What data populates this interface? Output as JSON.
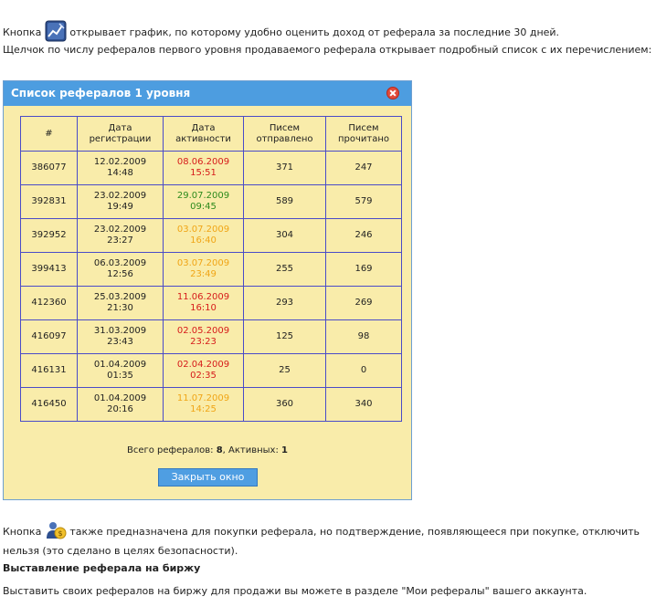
{
  "intro": {
    "line1_prefix": "Кнопка",
    "line1_suffix": "открывает график, по которому удобно оценить доход от реферала за последние 30 дней.",
    "paragraph2": "Щелчок по числу рефералов первого уровня продаваемого реферала открывает подробный список с их перечислением:"
  },
  "dialog": {
    "title": "Список рефералов 1 уровня",
    "headers": [
      "#",
      "Дата регистрации",
      "Дата активности",
      "Писем отправлено",
      "Писем прочитано"
    ],
    "rows": [
      {
        "id": "386077",
        "reg_date": "12.02.2009",
        "reg_time": "14:48",
        "act_date": "08.06.2009",
        "act_time": "15:51",
        "act_color": "red",
        "sent": "371",
        "read": "247"
      },
      {
        "id": "392831",
        "reg_date": "23.02.2009",
        "reg_time": "19:49",
        "act_date": "29.07.2009",
        "act_time": "09:45",
        "act_color": "green",
        "sent": "589",
        "read": "579"
      },
      {
        "id": "392952",
        "reg_date": "23.02.2009",
        "reg_time": "23:27",
        "act_date": "03.07.2009",
        "act_time": "16:40",
        "act_color": "orange",
        "sent": "304",
        "read": "246"
      },
      {
        "id": "399413",
        "reg_date": "06.03.2009",
        "reg_time": "12:56",
        "act_date": "03.07.2009",
        "act_time": "23:49",
        "act_color": "orange",
        "sent": "255",
        "read": "169"
      },
      {
        "id": "412360",
        "reg_date": "25.03.2009",
        "reg_time": "21:30",
        "act_date": "11.06.2009",
        "act_time": "16:10",
        "act_color": "red",
        "sent": "293",
        "read": "269"
      },
      {
        "id": "416097",
        "reg_date": "31.03.2009",
        "reg_time": "23:43",
        "act_date": "02.05.2009",
        "act_time": "23:23",
        "act_color": "red",
        "sent": "125",
        "read": "98"
      },
      {
        "id": "416131",
        "reg_date": "01.04.2009",
        "reg_time": "01:35",
        "act_date": "02.04.2009",
        "act_time": "02:35",
        "act_color": "red",
        "sent": "25",
        "read": "0"
      },
      {
        "id": "416450",
        "reg_date": "01.04.2009",
        "reg_time": "20:16",
        "act_date": "11.07.2009",
        "act_time": "14:25",
        "act_color": "orange",
        "sent": "360",
        "read": "340"
      }
    ],
    "summary": {
      "total_label": "Всего рефералов:",
      "total_value": "8",
      "active_label": ", Активных:",
      "active_value": "1"
    },
    "close_button": "Закрыть окно"
  },
  "after": {
    "line3_prefix": "Кнопка",
    "line3_suffix": "также предназначена для покупки реферала, но подтверждение, появляющееся при покупке, отключить нельзя (это сделано в целях безопасности).",
    "heading": "Выставление реферала на биржу",
    "paragraph4": "Выставить своих рефералов на биржу для продажи вы можете в разделе \"Мои рефералы\" вашего аккаунта."
  },
  "colors": {
    "red": "#d61b1b",
    "green": "#2d8a1c",
    "orange": "#f0a516",
    "dialog_header": "#4d9de0",
    "dialog_bg": "#f9ecaa"
  },
  "icons": {
    "chart_button": "chart-icon",
    "buy_button": "buy-referral-icon"
  }
}
